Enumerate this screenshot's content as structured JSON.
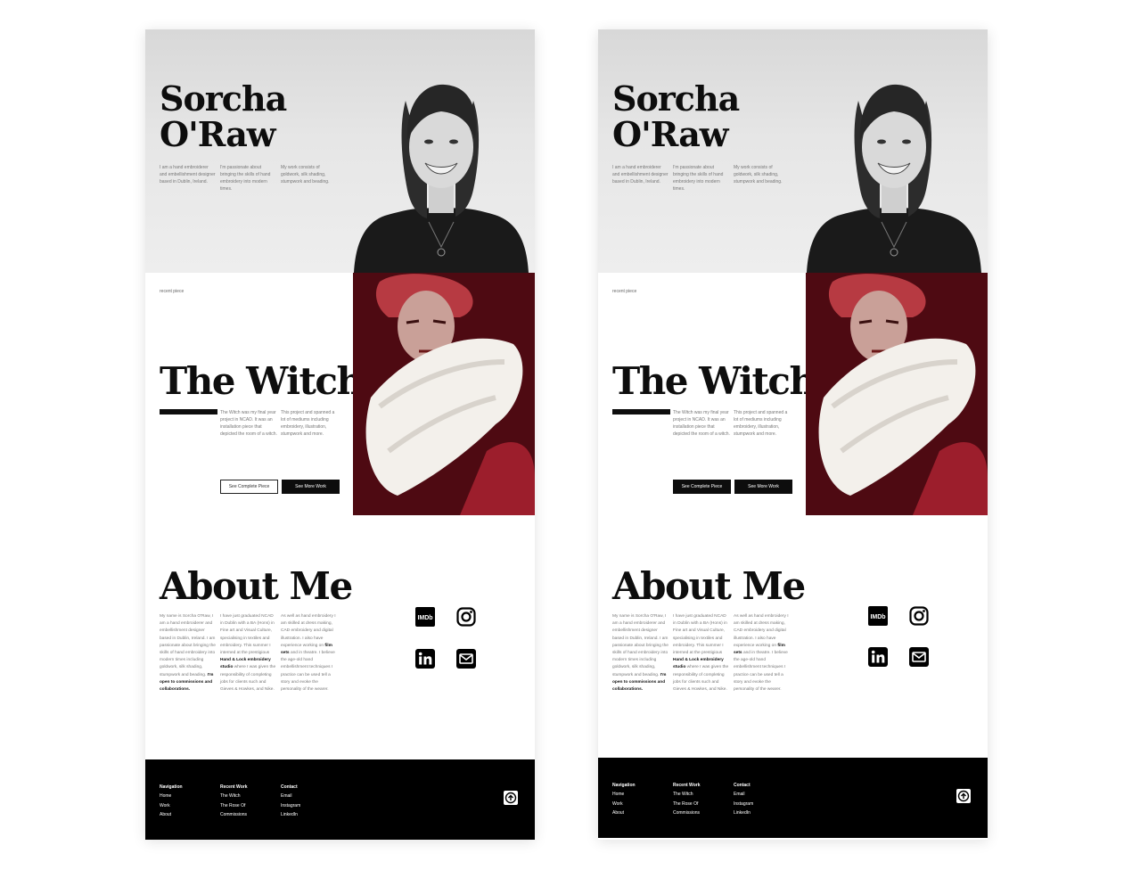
{
  "hero": {
    "name_line1": "Sorcha",
    "name_line2": "O'Raw",
    "col1": "I am a hand embroiderer and embellishment designer based in Dublin, Ireland.",
    "col2": "I'm passionate about bringing the skills of hand embroidery into modern times.",
    "col3": "My work consists of goldwork, silk shading, stumpwork and beading."
  },
  "witch": {
    "label": "recent piece",
    "title": "The Witch",
    "col1": "The Witch was my final year project in NCAD. It was an installation piece that depicted the room of a witch.",
    "col2": "This project and spanned a lot of mediums including embroidery, illustration, stumpwork and more.",
    "btn_complete": "See Complete Piece",
    "btn_more": "See More Work"
  },
  "about": {
    "title": "About Me",
    "col1_text": "My name is Sorcha O'Raw, I am a hand embroiderer and embellishment designer based in Dublin, Ireland. I am passionate about bringing the skills of hand embroidery into modern times including goldwork, silk shading, stumpwork and beading.",
    "col1_bold": "I'm open to commissions and collaborations.",
    "col2_a": "I have just graduated NCAD in Dublin with a BA (Hons) in Fine art and Visual Culture, specialising in textiles and embroidery. This summer I interned at the prestigious",
    "col2_bold": "Hand & Lock embroidery studio",
    "col2_b": "where I was given the responsibility of completing jobs for clients such and Gieves & Howkes, and Nike.",
    "col3_a": "As well as hand embroidery I am skilled at dress making, CAD embroidery and digital illustration. I also have experience working on",
    "col3_bold": "film sets",
    "col3_b": "and in theatre. I believe the age-old hand embellishment techniques I practice can be used tell a story and evoke the personality of the wearer."
  },
  "social": {
    "imdb_label": "IMDb",
    "icons": [
      "imdb-icon",
      "instagram-icon",
      "linkedin-icon",
      "mail-icon"
    ]
  },
  "footer": {
    "nav_heading": "Navigation",
    "nav_items": [
      "Home",
      "Work",
      "About"
    ],
    "recent_heading": "Recent Work",
    "recent_items": [
      "The Witch",
      "The Rose Of",
      "Commissions"
    ],
    "contact_heading": "Contact",
    "contact_items": [
      "Email",
      "Instagram",
      "LinkedIn"
    ]
  },
  "colors": {
    "black": "#0d0d0d",
    "art_red": "#8a1c26",
    "art_dark": "#4e0a12",
    "hero_bg": "#e6e6e6"
  }
}
